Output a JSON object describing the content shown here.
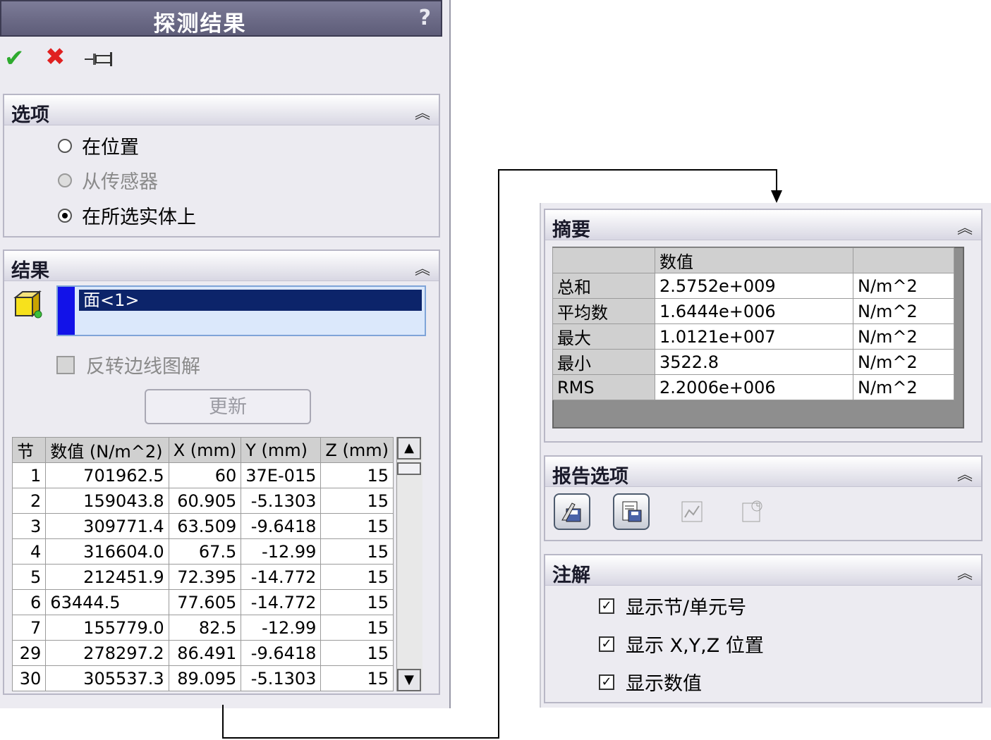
{
  "left": {
    "title": "探测结果",
    "help": "?",
    "toolbar": {
      "ok_icon": "checkmark-icon",
      "cancel_icon": "cross-icon",
      "pin_icon": "pushpin-icon"
    },
    "options": {
      "header": "选项",
      "radios": [
        {
          "label": "在位置",
          "checked": false,
          "disabled": false
        },
        {
          "label": "从传感器",
          "checked": false,
          "disabled": true
        },
        {
          "label": "在所选实体上",
          "checked": true,
          "disabled": false
        }
      ]
    },
    "results": {
      "header": "结果",
      "selection_item": "面<1>",
      "flip_edge_label": "反转边线图解",
      "update_label": "更新",
      "table": {
        "headers": [
          "节",
          "数值 (N/m^2)",
          "X (mm)",
          "Y (mm)",
          "Z (mm)"
        ],
        "rows": [
          [
            "1",
            "701962.5",
            "60",
            "37E-015",
            "15"
          ],
          [
            "2",
            "159043.8",
            "60.905",
            "-5.1303",
            "15"
          ],
          [
            "3",
            "309771.4",
            "63.509",
            "-9.6418",
            "15"
          ],
          [
            "4",
            "316604.0",
            "67.5",
            "-12.99",
            "15"
          ],
          [
            "5",
            "212451.9",
            "72.395",
            "-14.772",
            "15"
          ],
          [
            "6",
            "63444.5",
            "77.605",
            "-14.772",
            "15"
          ],
          [
            "7",
            "155779.0",
            "82.5",
            "-12.99",
            "15"
          ],
          [
            "29",
            "278297.2",
            "86.491",
            "-9.6418",
            "15"
          ],
          [
            "30",
            "305537.3",
            "89.095",
            "-5.1303",
            "15"
          ]
        ]
      }
    }
  },
  "right": {
    "summary": {
      "header": "摘要",
      "col_header": "数值",
      "rows": [
        [
          "总和",
          "2.5752e+009",
          "N/m^2"
        ],
        [
          "平均数",
          "1.6444e+006",
          "N/m^2"
        ],
        [
          "最大",
          "1.0121e+007",
          "N/m^2"
        ],
        [
          "最小",
          "3522.8",
          "N/m^2"
        ],
        [
          "RMS",
          "2.2006e+006",
          "N/m^2"
        ]
      ]
    },
    "report": {
      "header": "报告选项"
    },
    "annotation": {
      "header": "注解",
      "checks": [
        "显示节/单元号",
        "显示 X,Y,Z 位置",
        "显示数值"
      ]
    }
  }
}
